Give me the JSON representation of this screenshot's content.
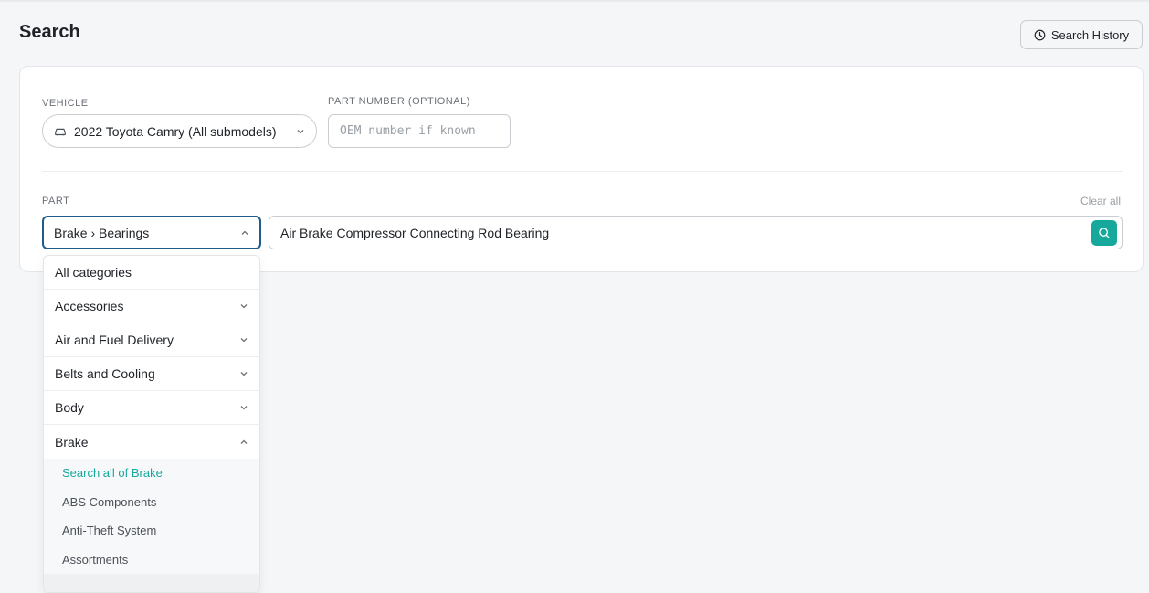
{
  "page": {
    "title": "Search",
    "history_button_label": "Search History"
  },
  "vehicle": {
    "label": "VEHICLE",
    "selected": "2022 Toyota Camry (All submodels)"
  },
  "part_number": {
    "label": "PART NUMBER (OPTIONAL)",
    "placeholder": "OEM number if known"
  },
  "part": {
    "label": "PART",
    "clear_all": "Clear all",
    "category_selected": "Brake › Bearings",
    "query_value": "Air Brake Compressor Connecting Rod Bearing"
  },
  "dropdown": {
    "items": [
      {
        "label": "All categories"
      },
      {
        "label": "Accessories"
      },
      {
        "label": "Air and Fuel Delivery"
      },
      {
        "label": "Belts and Cooling"
      },
      {
        "label": "Body"
      },
      {
        "label": "Brake"
      }
    ],
    "brake_subitems": [
      {
        "label": "Search all of Brake"
      },
      {
        "label": "ABS Components"
      },
      {
        "label": "Anti-Theft System"
      },
      {
        "label": "Assortments"
      }
    ]
  },
  "colors": {
    "accent": "#17a89c",
    "focus_border": "#1f5c8a"
  },
  "icons": {
    "history": "clock-icon",
    "vehicle": "car-icon",
    "chevron": "chevron-down-icon",
    "search": "search-icon"
  }
}
